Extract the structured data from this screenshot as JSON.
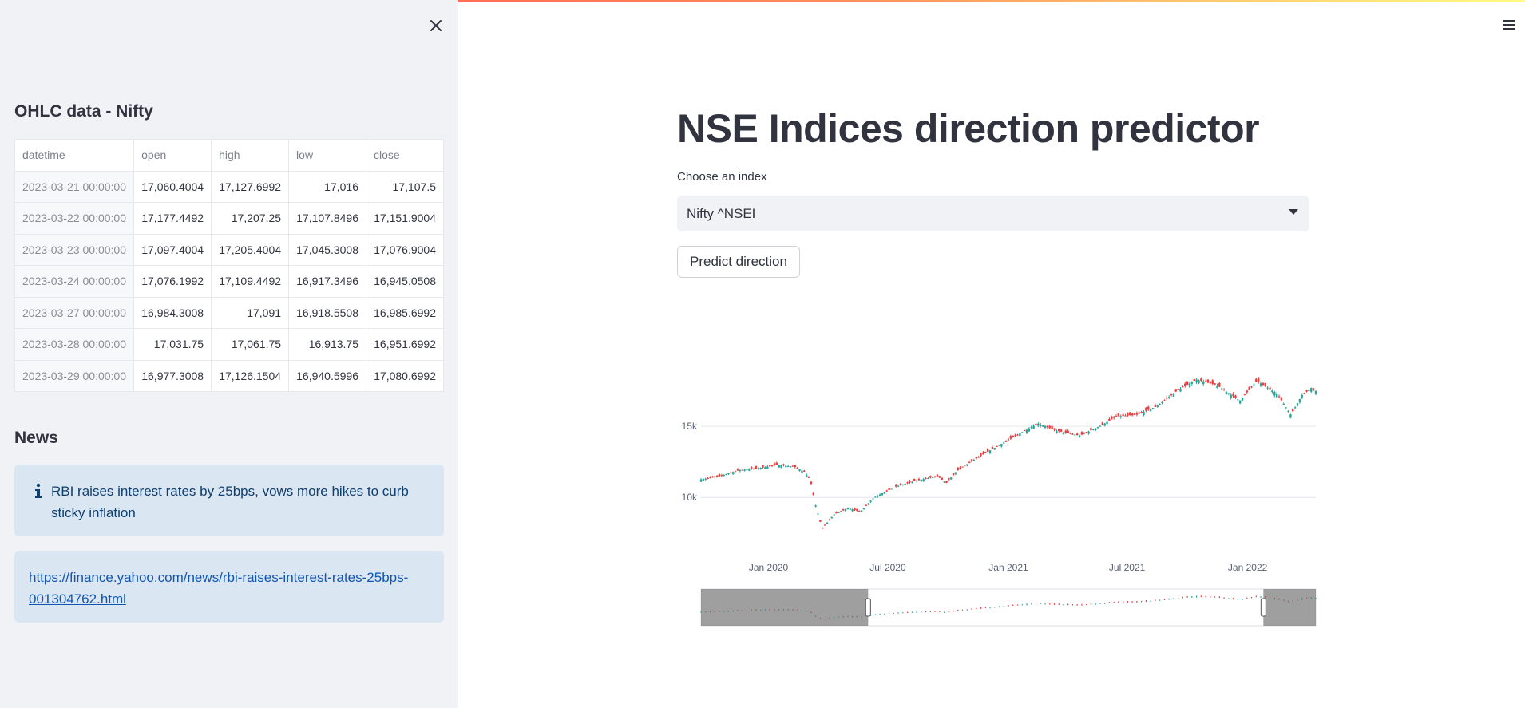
{
  "sidebar": {
    "close_icon": "close-icon",
    "title": "OHLC data - Nifty",
    "table": {
      "columns": [
        "datetime",
        "open",
        "high",
        "low",
        "close"
      ],
      "rows": [
        [
          "2023-03-21 00:00:00",
          "17,060.4004",
          "17,127.6992",
          "17,016",
          "17,107.5"
        ],
        [
          "2023-03-22 00:00:00",
          "17,177.4492",
          "17,207.25",
          "17,107.8496",
          "17,151.9004"
        ],
        [
          "2023-03-23 00:00:00",
          "17,097.4004",
          "17,205.4004",
          "17,045.3008",
          "17,076.9004"
        ],
        [
          "2023-03-24 00:00:00",
          "17,076.1992",
          "17,109.4492",
          "16,917.3496",
          "16,945.0508"
        ],
        [
          "2023-03-27 00:00:00",
          "16,984.3008",
          "17,091",
          "16,918.5508",
          "16,985.6992"
        ],
        [
          "2023-03-28 00:00:00",
          "17,031.75",
          "17,061.75",
          "16,913.75",
          "16,951.6992"
        ],
        [
          "2023-03-29 00:00:00",
          "16,977.3008",
          "17,126.1504",
          "16,940.5996",
          "17,080.6992"
        ]
      ]
    },
    "news_title": "News",
    "news_headline": "RBI raises interest rates by 25bps, vows more hikes to curb sticky inflation",
    "news_url": "https://finance.yahoo.com/news/rbi-raises-interest-rates-25bps-001304762.html"
  },
  "main": {
    "menu_icon": "hamburger-menu-icon",
    "title": "NSE Indices direction predictor",
    "select_label": "Choose an index",
    "select_value": "Nifty ^NSEI",
    "predict_button": "Predict direction"
  },
  "colors": {
    "accent": "#ff4b4b",
    "increasing": "#26a69a",
    "decreasing": "#ef3b3b",
    "sidebar_bg": "#f0f2f6",
    "info_bg": "#dbe6f3"
  },
  "chart_data": {
    "type": "candlestick",
    "title": "",
    "xlabel": "",
    "ylabel": "",
    "x_ticks": [
      "Jan 2020",
      "Jul 2020",
      "Jan 2021",
      "Jul 2021",
      "Jan 2022"
    ],
    "y_ticks": [
      "10k",
      "15k"
    ],
    "y_tick_values": [
      10000,
      15000
    ],
    "ylim": [
      7600,
      18600
    ],
    "xlim": [
      "2019-09-20",
      "2022-04-15"
    ],
    "grid": true,
    "range_slider": true,
    "range_slider_selection": [
      "2020-06-01",
      "2022-01-25"
    ],
    "series": [
      {
        "name": "Nifty ^NSEI",
        "approx_close": [
          [
            "2019-09-20",
            11270
          ],
          [
            "2019-10-15",
            11450
          ],
          [
            "2019-11-15",
            11900
          ],
          [
            "2019-12-15",
            12050
          ],
          [
            "2020-01-15",
            12300
          ],
          [
            "2020-02-10",
            12150
          ],
          [
            "2020-02-25",
            11800
          ],
          [
            "2020-03-05",
            11200
          ],
          [
            "2020-03-12",
            9600
          ],
          [
            "2020-03-23",
            7800
          ],
          [
            "2020-04-10",
            8800
          ],
          [
            "2020-05-01",
            9250
          ],
          [
            "2020-05-20",
            9000
          ],
          [
            "2020-06-10",
            10000
          ],
          [
            "2020-07-15",
            10800
          ],
          [
            "2020-08-15",
            11200
          ],
          [
            "2020-09-15",
            11500
          ],
          [
            "2020-09-28",
            11000
          ],
          [
            "2020-10-15",
            11900
          ],
          [
            "2020-11-15",
            12800
          ],
          [
            "2020-12-15",
            13600
          ],
          [
            "2021-01-15",
            14400
          ],
          [
            "2021-02-15",
            15200
          ],
          [
            "2021-03-15",
            14700
          ],
          [
            "2021-04-20",
            14350
          ],
          [
            "2021-05-20",
            15000
          ],
          [
            "2021-06-15",
            15700
          ],
          [
            "2021-07-15",
            15800
          ],
          [
            "2021-08-15",
            16400
          ],
          [
            "2021-09-15",
            17500
          ],
          [
            "2021-10-15",
            18300
          ],
          [
            "2021-11-15",
            17900
          ],
          [
            "2021-12-20",
            16800
          ],
          [
            "2022-01-15",
            18200
          ],
          [
            "2022-02-15",
            17300
          ],
          [
            "2022-03-08",
            15800
          ],
          [
            "2022-03-25",
            17200
          ],
          [
            "2022-04-08",
            17700
          ],
          [
            "2022-04-15",
            17500
          ]
        ]
      }
    ]
  }
}
